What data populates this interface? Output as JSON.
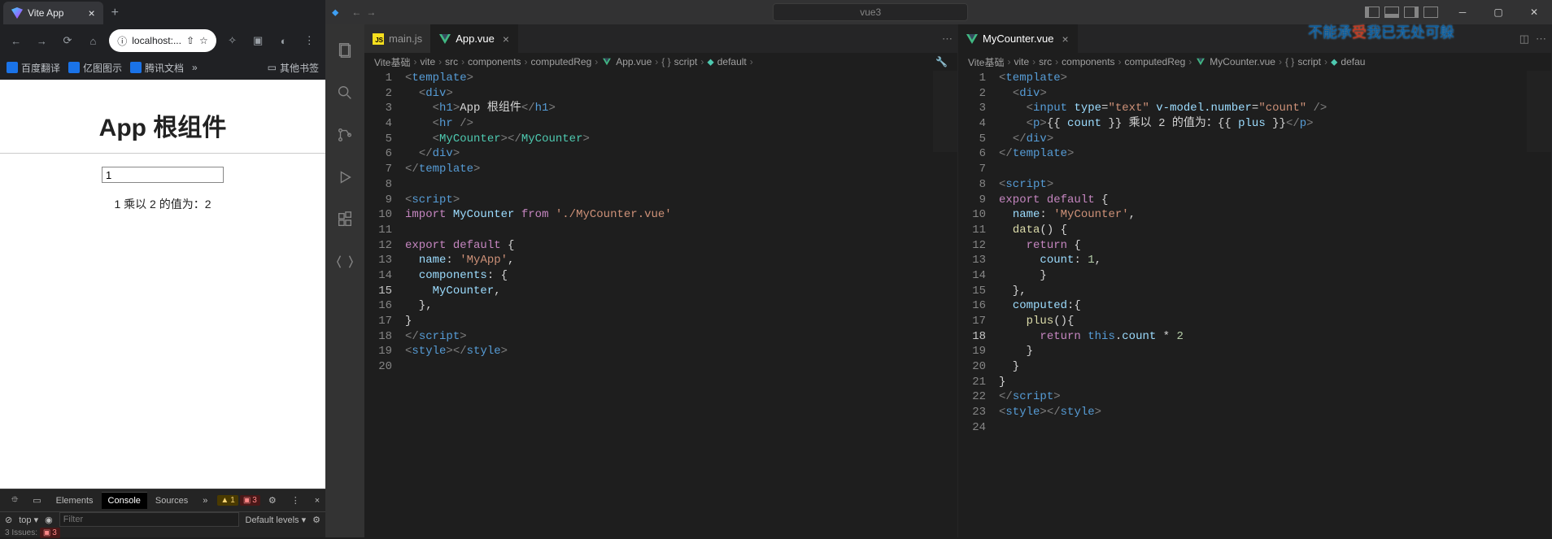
{
  "browser": {
    "tab_title": "Vite App",
    "url_display": "localhost:...",
    "bookmarks": [
      "百度翻译",
      "亿图图示",
      "腾讯文档"
    ],
    "bookmark_more": "»",
    "bookmark_other": "其他书签",
    "page_h1": "App 根组件",
    "input_value": "1",
    "result_text": "1 乘以 2 的值为：2"
  },
  "devtools": {
    "tabs": [
      "Elements",
      "Console",
      "Sources"
    ],
    "more": "»",
    "warn_count": "1",
    "err_count": "3",
    "top_label": "top ▾",
    "filter_placeholder": "Filter",
    "levels": "Default levels ▾",
    "issues_label": "3 Issues:",
    "issues_count": "3"
  },
  "vscode": {
    "search_text": "vue3",
    "overlay": "不能承受我已无处可躲",
    "editor1": {
      "tabs": [
        {
          "label": "main.js",
          "type": "js",
          "active": false
        },
        {
          "label": "App.vue",
          "type": "vue",
          "active": true
        }
      ],
      "crumbs": [
        "Vite基础",
        "vite",
        "src",
        "components",
        "computedReg",
        "App.vue",
        "script",
        "default"
      ],
      "lines": 20,
      "active_line": 15
    },
    "editor2": {
      "tabs": [
        {
          "label": "MyCounter.vue",
          "type": "vue",
          "active": true
        }
      ],
      "crumbs": [
        "Vite基础",
        "vite",
        "src",
        "components",
        "computedReg",
        "MyCounter.vue",
        "script",
        "defau"
      ],
      "lines": 24,
      "active_line": 18
    }
  }
}
